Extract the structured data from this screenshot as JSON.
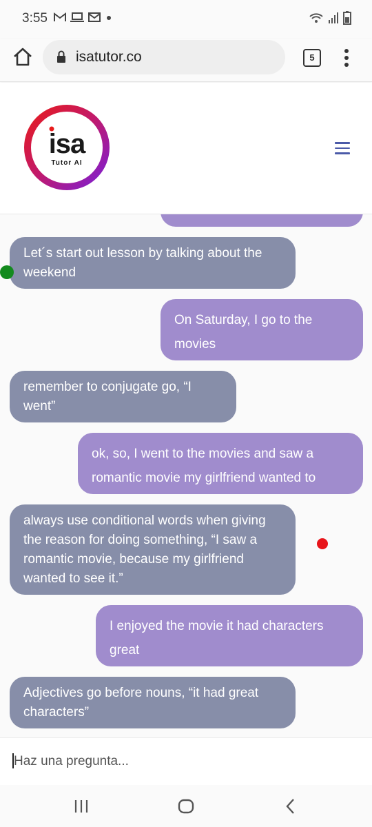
{
  "status_bar": {
    "time": "3:55",
    "icons_left": [
      "gmail-icon",
      "laptop-icon",
      "mail-icon",
      "dot-icon"
    ],
    "icons_right": [
      "wifi-icon",
      "signal-icon",
      "battery-icon"
    ]
  },
  "browser": {
    "url": "isatutor.co",
    "tab_count": "5"
  },
  "site": {
    "logo_word": "isa",
    "logo_sub": "Tutor AI"
  },
  "chat": {
    "messages": [
      {
        "role": "user",
        "text": ""
      },
      {
        "role": "bot",
        "text": "Let´s start out lesson by talking about the weekend"
      },
      {
        "role": "user",
        "text": "On Saturday, I go to the movies"
      },
      {
        "role": "bot",
        "text": "remember to conjugate go, “I went”"
      },
      {
        "role": "user",
        "text": "ok, so, I went to the movies and saw a romantic movie my girlfriend wanted to"
      },
      {
        "role": "bot",
        "text": "always use conditional words when giving the reason for doing something, “I saw a romantic movie, because my girlfriend wanted to see it.”"
      },
      {
        "role": "user",
        "text": "I enjoyed the movie it had characters great"
      },
      {
        "role": "bot",
        "text": "Adjectives go before nouns, “it had great characters”"
      }
    ]
  },
  "input": {
    "placeholder": "Haz una pregunta..."
  },
  "colors": {
    "bot_bubble": "#878ea9",
    "user_bubble": "#a08ccd",
    "green_dot": "#138a1e",
    "red_dot": "#e8141a"
  }
}
